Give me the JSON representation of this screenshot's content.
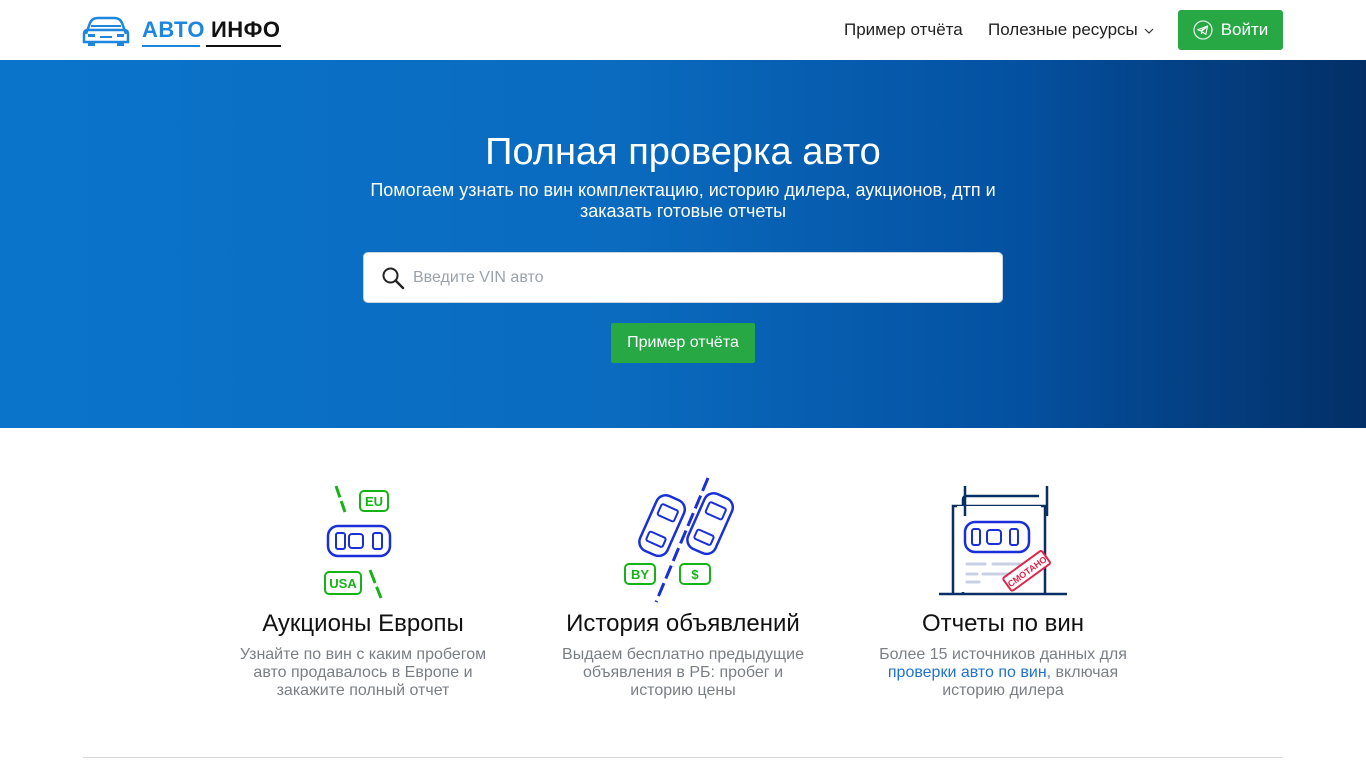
{
  "header": {
    "logo_word1": "АВТО",
    "logo_word2": "ИНФО",
    "nav_sample": "Пример отчёта",
    "nav_resources": "Полезные ресурсы",
    "login": "Войти"
  },
  "hero": {
    "title": "Полная проверка авто",
    "subtitle": "Помогаем узнать по вин комплектацию, историю дилера, аукционов, дтп и заказать готовые отчеты",
    "search_placeholder": "Введите VIN авто",
    "sample_button": "Пример отчёта"
  },
  "features": [
    {
      "title": "Аукционы Европы",
      "desc": "Узнайте по вин с каким пробегом авто продавалось в Европе и закажите полный отчет",
      "badge_top": "EU",
      "badge_bottom": "USA"
    },
    {
      "title": "История объявлений",
      "desc": "Выдаем бесплатно предыдущие объявления в РБ: пробег и историю цены",
      "badge_left": "BY",
      "badge_right": "$"
    },
    {
      "title": "Отчеты по вин",
      "desc_before": "Более 15 источников данных для ",
      "desc_link": "проверки авто по вин",
      "desc_after": ", включая историю дилера",
      "stamp": "СМОТАНО"
    }
  ],
  "colors": {
    "brand_blue": "#1f86e0",
    "green": "#28a745",
    "icon_blue": "#1a2fd8",
    "icon_green": "#16b316"
  }
}
